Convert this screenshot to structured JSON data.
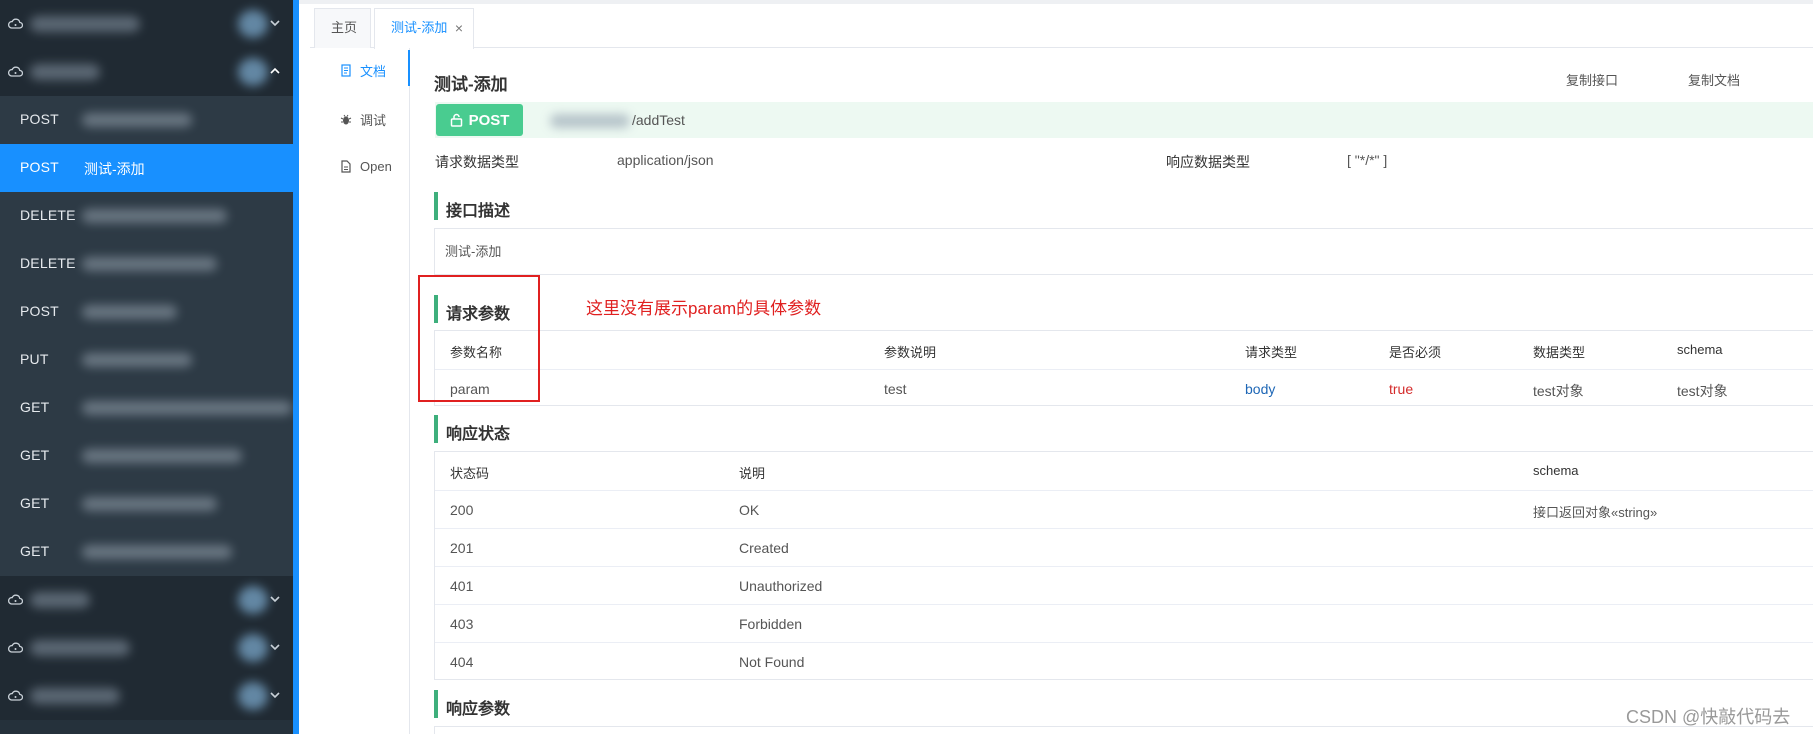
{
  "sidebar": {
    "groups_top": [
      {
        "name": ""
      },
      {
        "name": ""
      }
    ],
    "items": [
      {
        "method": "POST",
        "label": ""
      },
      {
        "method": "POST",
        "label": "测试-添加",
        "active": true
      },
      {
        "method": "DELETE",
        "label": ""
      },
      {
        "method": "DELETE",
        "label": ""
      },
      {
        "method": "POST",
        "label": ""
      },
      {
        "method": "PUT",
        "label": ""
      },
      {
        "method": "GET",
        "label": ""
      },
      {
        "method": "GET",
        "label": ""
      },
      {
        "method": "GET",
        "label": ""
      },
      {
        "method": "GET",
        "label": ""
      }
    ],
    "groups_bottom": [
      {
        "name": ""
      },
      {
        "name": ""
      },
      {
        "name": ""
      }
    ]
  },
  "tabs": [
    {
      "label": "主页"
    },
    {
      "label": "测试-添加",
      "close": "×"
    }
  ],
  "sidenav": [
    {
      "label": "文档",
      "icon": "document-icon"
    },
    {
      "label": "调试",
      "icon": "bug-icon"
    },
    {
      "label": "Open",
      "icon": "file-icon"
    }
  ],
  "api": {
    "title": "测试-添加",
    "copy_api": "复制接口",
    "copy_doc": "复制文档",
    "method": "POST",
    "path": "/addTest",
    "request_type_label": "请求数据类型",
    "request_type": "application/json",
    "response_type_label": "响应数据类型",
    "response_type": "[ \"*/*\" ]"
  },
  "description": {
    "heading": "接口描述",
    "text": "测试-添加"
  },
  "request_params": {
    "heading": "请求参数",
    "columns": [
      "参数名称",
      "参数说明",
      "请求类型",
      "是否必须",
      "数据类型",
      "schema"
    ],
    "rows": [
      {
        "name": "param",
        "desc": "test",
        "in": "body",
        "required": "true",
        "type": "test对象",
        "schema": "test对象"
      }
    ]
  },
  "response_status": {
    "heading": "响应状态",
    "columns": [
      "状态码",
      "说明",
      "schema"
    ],
    "rows": [
      {
        "code": "200",
        "desc": "OK",
        "schema": "接口返回对象«string»"
      },
      {
        "code": "201",
        "desc": "Created",
        "schema": ""
      },
      {
        "code": "401",
        "desc": "Unauthorized",
        "schema": ""
      },
      {
        "code": "403",
        "desc": "Forbidden",
        "schema": ""
      },
      {
        "code": "404",
        "desc": "Not Found",
        "schema": ""
      }
    ]
  },
  "response_params": {
    "heading": "响应参数"
  },
  "annotation": {
    "text": "这里没有展示param的具体参数"
  },
  "watermark": "CSDN @快敲代码去",
  "colors": {
    "accent": "#1890ff",
    "post": "#49cc90",
    "section_bar": "#3eaf7c",
    "annotation": "#e02020",
    "sidebar_bg": "#25313b"
  }
}
